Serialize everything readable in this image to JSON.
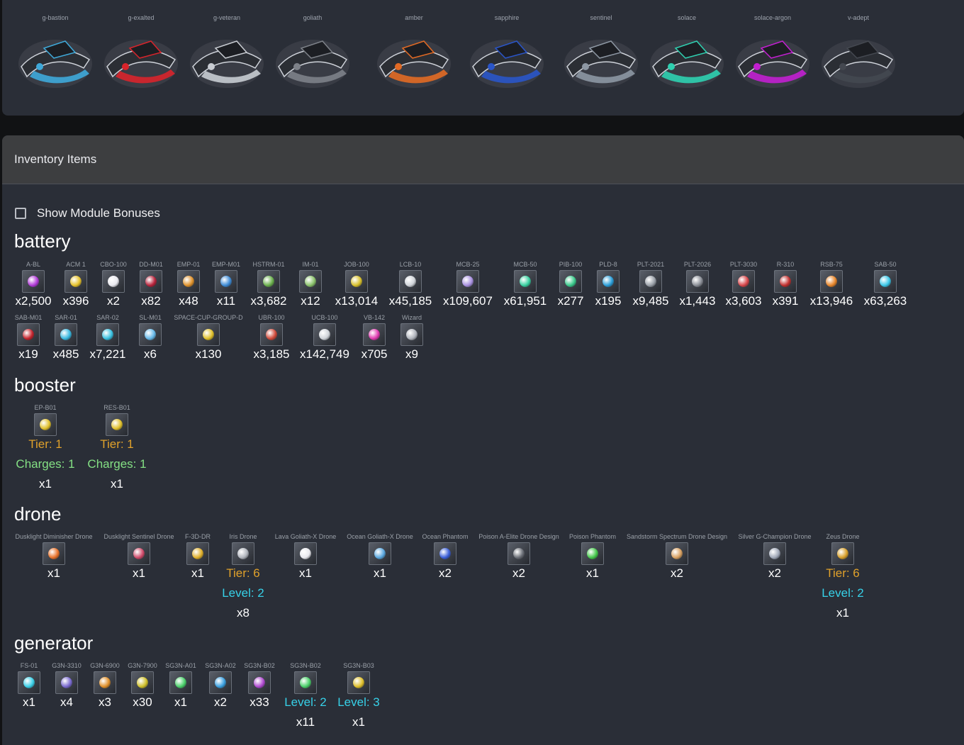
{
  "ships": [
    {
      "name": "g-bastion",
      "color": "#3fa9d9"
    },
    {
      "name": "g-exalted",
      "color": "#d8242b"
    },
    {
      "name": "g-veteran",
      "color": "#c8ccd2"
    },
    {
      "name": "goliath",
      "color": "#7d8188"
    },
    {
      "name": "amber",
      "color": "#e26a24"
    },
    {
      "name": "sapphire",
      "color": "#2a55c8"
    },
    {
      "name": "sentinel",
      "color": "#8d97a3"
    },
    {
      "name": "solace",
      "color": "#2fd0b0"
    },
    {
      "name": "solace-argon",
      "color": "#c21fd0"
    },
    {
      "name": "v-adept",
      "color": "#444850"
    }
  ],
  "inventory": {
    "title": "Inventory Items",
    "show_bonuses_label": "Show Module Bonuses",
    "categories": {
      "battery": {
        "title": "battery",
        "row1": [
          {
            "name": "A-BL",
            "count": "x2,500",
            "color": "#b23bd8"
          },
          {
            "name": "ACM 1",
            "count": "x396",
            "color": "#e6c22a"
          },
          {
            "name": "CBO-100",
            "count": "x2",
            "color": "#e9e9ef"
          },
          {
            "name": "DD-M01",
            "count": "x82",
            "color": "#b8233b"
          },
          {
            "name": "EMP-01",
            "count": "x48",
            "color": "#e0922b"
          },
          {
            "name": "EMP-M01",
            "count": "x11",
            "color": "#3d8bd6"
          },
          {
            "name": "HSTRM-01",
            "count": "x3,682",
            "color": "#6ab04c"
          },
          {
            "name": "IM-01",
            "count": "x12",
            "color": "#8ac26a"
          },
          {
            "name": "JOB-100",
            "count": "x13,014",
            "color": "#d8c02a"
          },
          {
            "name": "LCB-10",
            "count": "x45,185",
            "color": "#cfd3d8"
          },
          {
            "name": "MCB-25",
            "count": "x109,607",
            "color": "#a890e0"
          },
          {
            "name": "MCB-50",
            "count": "x61,951",
            "color": "#38d0a0"
          },
          {
            "name": "PIB-100",
            "count": "x277",
            "color": "#39c98a"
          },
          {
            "name": "PLD-8",
            "count": "x195",
            "color": "#2a9ed9"
          },
          {
            "name": "PLT-2021",
            "count": "x9,485",
            "color": "#9aa0a8"
          },
          {
            "name": "PLT-2026",
            "count": "x1,443",
            "color": "#8a8e96"
          },
          {
            "name": "PLT-3030",
            "count": "x3,603",
            "color": "#d8474b"
          },
          {
            "name": "R-310",
            "count": "x391",
            "color": "#c2302f"
          },
          {
            "name": "RSB-75",
            "count": "x13,946",
            "color": "#e8862a"
          },
          {
            "name": "SAB-50",
            "count": "x63,263",
            "color": "#3bc7e8"
          }
        ],
        "row2": [
          {
            "name": "SAB-M01",
            "count": "x19",
            "color": "#c6242d"
          },
          {
            "name": "SAR-01",
            "count": "x485",
            "color": "#38b8e0"
          },
          {
            "name": "SAR-02",
            "count": "x7,221",
            "color": "#38c0e0"
          },
          {
            "name": "SL-M01",
            "count": "x6",
            "color": "#66b8e8"
          },
          {
            "name": "SPACE-CUP-GROUP-D",
            "count": "x130",
            "color": "#e0c02a"
          },
          {
            "name": "UBR-100",
            "count": "x3,185",
            "color": "#d04a3a"
          },
          {
            "name": "UCB-100",
            "count": "x142,749",
            "color": "#cfd3d8"
          },
          {
            "name": "VB-142",
            "count": "x705",
            "color": "#e03ab0"
          },
          {
            "name": "Wizard",
            "count": "x9",
            "color": "#b0b4bc"
          }
        ]
      },
      "booster": {
        "title": "booster",
        "items": [
          {
            "name": "EP-B01",
            "tier": "Tier: 1",
            "charges": "Charges: 1",
            "count": "x1",
            "color": "#e0c02a"
          },
          {
            "name": "RES-B01",
            "tier": "Tier: 1",
            "charges": "Charges: 1",
            "count": "x1",
            "color": "#e0c02a"
          }
        ]
      },
      "drone": {
        "title": "drone",
        "items": [
          {
            "name": "Dusklight Diminisher Drone",
            "count": "x1",
            "color": "#e8722a"
          },
          {
            "name": "Dusklight Sentinel Drone",
            "count": "x1",
            "color": "#d04a6a"
          },
          {
            "name": "F-3D-DR",
            "count": "x1",
            "color": "#e0b02a"
          },
          {
            "name": "Iris Drone",
            "tier": "Tier: 6",
            "level": "Level: 2",
            "count": "x8",
            "color": "#b0b4bc"
          },
          {
            "name": "Lava Goliath-X Drone",
            "count": "x1",
            "color": "#e8e8ee"
          },
          {
            "name": "Ocean Goliath-X Drone",
            "count": "x1",
            "color": "#5aa8e0"
          },
          {
            "name": "Ocean Phantom",
            "count": "x2",
            "color": "#3a5ed8"
          },
          {
            "name": "Poison A-Elite Drone Design",
            "count": "x2",
            "color": "#6a6e76"
          },
          {
            "name": "Poison Phantom",
            "count": "x1",
            "color": "#44c84a"
          },
          {
            "name": "Sandstorm Spectrum Drone Design",
            "count": "x2",
            "color": "#d8a060"
          },
          {
            "name": "Silver G-Champion Drone",
            "count": "x2",
            "color": "#a0a8b8"
          },
          {
            "name": "Zeus Drone",
            "tier": "Tier: 6",
            "level": "Level: 2",
            "count": "x1",
            "color": "#d8a02a"
          }
        ]
      },
      "generator": {
        "title": "generator",
        "items": [
          {
            "name": "FS-01",
            "count": "x1",
            "color": "#3ad0e8"
          },
          {
            "name": "G3N-3310",
            "count": "x4",
            "color": "#7a6ad0"
          },
          {
            "name": "G3N-6900",
            "count": "x3",
            "color": "#e0902a"
          },
          {
            "name": "G3N-7900",
            "count": "x30",
            "color": "#d0c02a"
          },
          {
            "name": "SG3N-A01",
            "count": "x1",
            "color": "#4ad06a"
          },
          {
            "name": "SG3N-A02",
            "count": "x2",
            "color": "#3aa0e0"
          },
          {
            "name": "SG3N-B02",
            "count": "x33",
            "color": "#b04ad0"
          },
          {
            "name": "SG3N-B02",
            "level": "Level: 2",
            "count": "x11",
            "color": "#4ad06a"
          },
          {
            "name": "SG3N-B03",
            "level": "Level: 3",
            "count": "x1",
            "color": "#e0c02a"
          }
        ]
      }
    }
  }
}
